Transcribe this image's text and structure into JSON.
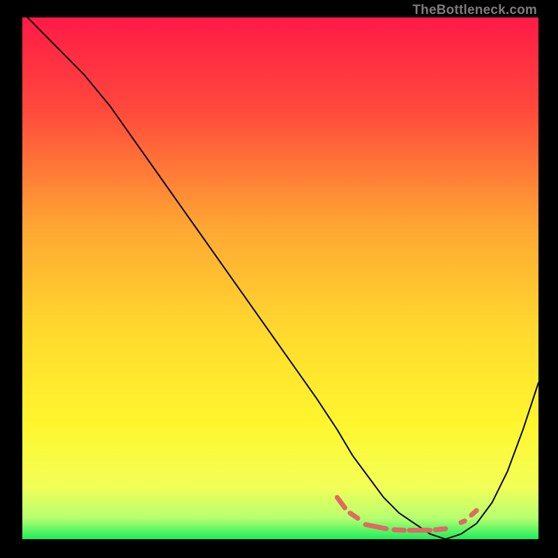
{
  "watermark": "TheBottleneck.com",
  "chart_data": {
    "type": "line",
    "title": "",
    "xlabel": "",
    "ylabel": "",
    "xlim": [
      0,
      100
    ],
    "ylim": [
      0,
      100
    ],
    "gradient": {
      "stops": [
        {
          "offset": 0,
          "color": "#ff1a47"
        },
        {
          "offset": 18,
          "color": "#ff4a3c"
        },
        {
          "offset": 40,
          "color": "#ffa633"
        },
        {
          "offset": 60,
          "color": "#ffd92e"
        },
        {
          "offset": 78,
          "color": "#fff62e"
        },
        {
          "offset": 90,
          "color": "#f2ff57"
        },
        {
          "offset": 96,
          "color": "#b6ff70"
        },
        {
          "offset": 100,
          "color": "#1dee5b"
        }
      ]
    },
    "series": [
      {
        "name": "bottleneck-curve",
        "color": "#000000",
        "width": 2.0,
        "x": [
          0,
          3,
          7,
          12,
          17,
          22,
          27,
          32,
          37,
          42,
          47,
          52,
          57,
          61,
          64,
          67,
          70,
          73,
          76,
          79,
          82,
          85,
          88,
          91,
          94,
          97,
          100
        ],
        "y": [
          101,
          98,
          94,
          89,
          83,
          76,
          69,
          62,
          55,
          48,
          41,
          34,
          27,
          21,
          16,
          12,
          8,
          5,
          3,
          1,
          0,
          1,
          3,
          7,
          13,
          21,
          30
        ]
      },
      {
        "name": "salmon-dash-markers",
        "color": "#df6a64",
        "type": "dashed-segments",
        "segments": [
          {
            "x1": 61,
            "y1": 8.0,
            "x2": 62.5,
            "y2": 6.0
          },
          {
            "x1": 63.5,
            "y1": 5.0,
            "x2": 65.0,
            "y2": 4.0
          },
          {
            "x1": 66.5,
            "y1": 2.8,
            "x2": 70.5,
            "y2": 2.0
          },
          {
            "x1": 72.0,
            "y1": 1.8,
            "x2": 74.0,
            "y2": 1.7
          },
          {
            "x1": 75.0,
            "y1": 1.7,
            "x2": 79.0,
            "y2": 1.7
          },
          {
            "x1": 80.0,
            "y1": 1.8,
            "x2": 82.0,
            "y2": 2.0
          },
          {
            "x1": 85.0,
            "y1": 3.2,
            "x2": 85.7,
            "y2": 3.5
          },
          {
            "x1": 87.0,
            "y1": 4.6,
            "x2": 88.0,
            "y2": 5.5
          }
        ]
      }
    ]
  }
}
